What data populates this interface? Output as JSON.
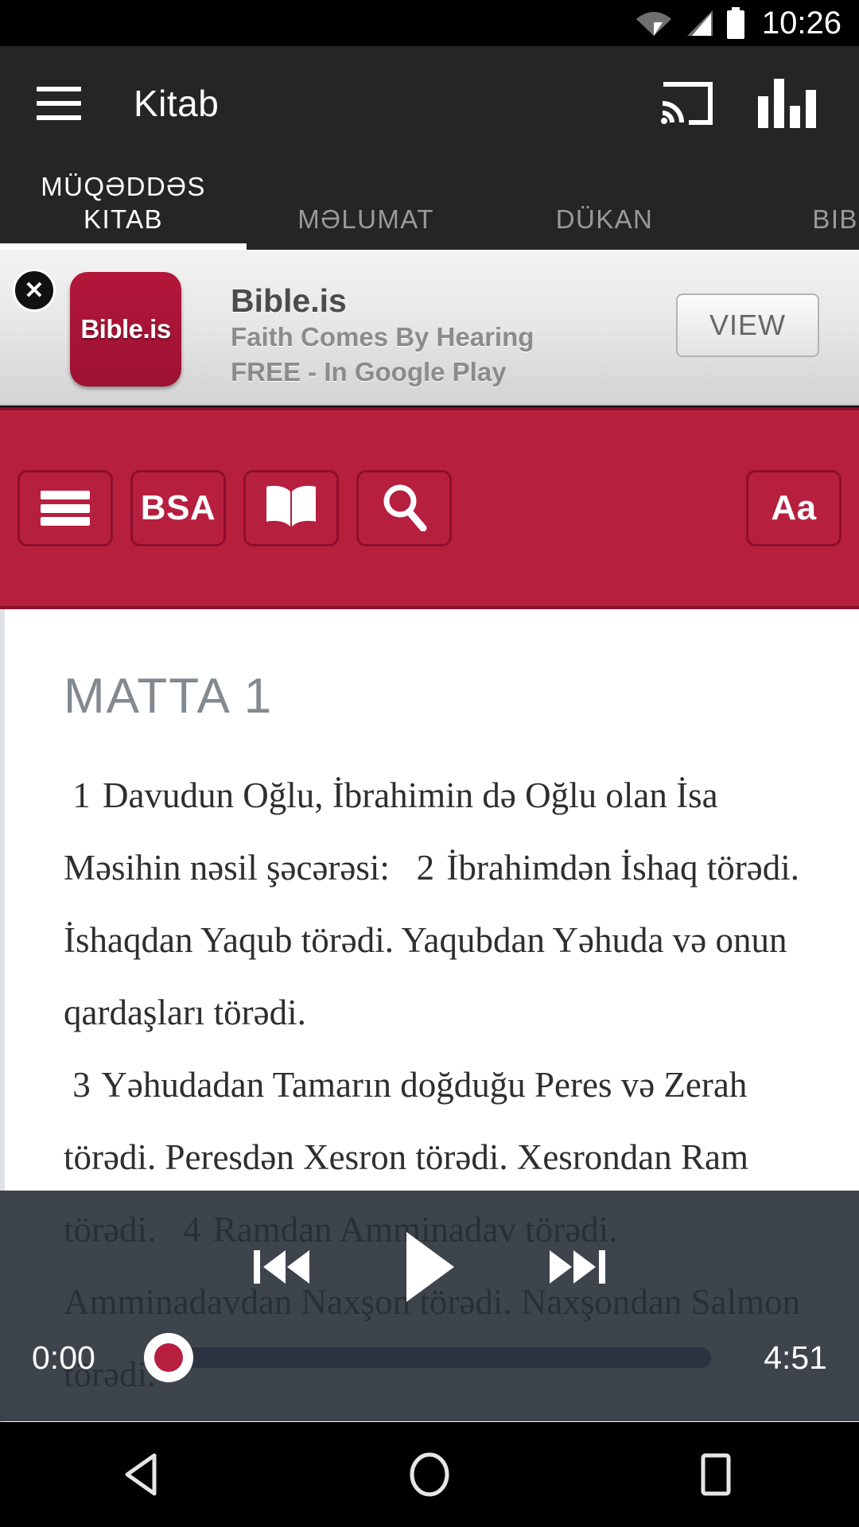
{
  "statusbar": {
    "time": "10:26",
    "icons": [
      "wifi-icon",
      "signal-icon",
      "battery-icon"
    ]
  },
  "appbar": {
    "title": "Kitab",
    "menu_icon": "hamburger-menu-icon",
    "cast_icon": "cast-icon",
    "equalizer_icon": "equalizer-icon"
  },
  "tabs": [
    {
      "label": "MÜQƏDDƏS KITAB",
      "active": true
    },
    {
      "label": "MƏLUMAT",
      "active": false
    },
    {
      "label": "DÜKAN",
      "active": false
    },
    {
      "label": "BIBL",
      "active": false
    }
  ],
  "ad": {
    "close_label": "✕",
    "logo_text": "Bible.is",
    "title": "Bible.is",
    "subtitle": "Faith Comes By Hearing",
    "price_line": "FREE - In Google Play",
    "view_label": "VIEW"
  },
  "reader_toolbar": {
    "menu_icon": "hamburger-menu-icon",
    "version_label": "BSA",
    "book_icon": "open-book-icon",
    "search_icon": "search-icon",
    "font_label": "Aa",
    "accent_color": "#b71f3f"
  },
  "reader": {
    "chapter_title": "MATTA 1",
    "verses": [
      {
        "number": "1",
        "text": "Davudun Oğlu, İbrahimin də Oğlu olan İsa Məsihin nəsil şəcərəsi:"
      },
      {
        "number": "2",
        "text": "İbrahimdən İshaq törədi. İshaqdan Yaqub törədi. Yaqubdan Yəhuda və onun qardaşları törədi."
      },
      {
        "number": "3",
        "text": "Yəhudadan Tamarın doğduğu Peres və Zerah törədi. Peresdən Xesron törədi. Xesrondan Ram törədi."
      },
      {
        "number": "4",
        "text": "Ramdan Amminadav törədi. Amminadavdan Naxşon törədi. Naxşondan Salmon törədi."
      }
    ]
  },
  "player": {
    "previous_icon": "skip-previous-icon",
    "play_icon": "play-icon",
    "next_icon": "skip-next-icon",
    "current_time": "0:00",
    "total_time": "4:51",
    "progress_percent": 0,
    "thumb_color": "#b71f3f"
  },
  "navbar": {
    "back_icon": "back-triangle-icon",
    "home_icon": "home-circle-icon",
    "recents_icon": "recents-square-icon"
  }
}
